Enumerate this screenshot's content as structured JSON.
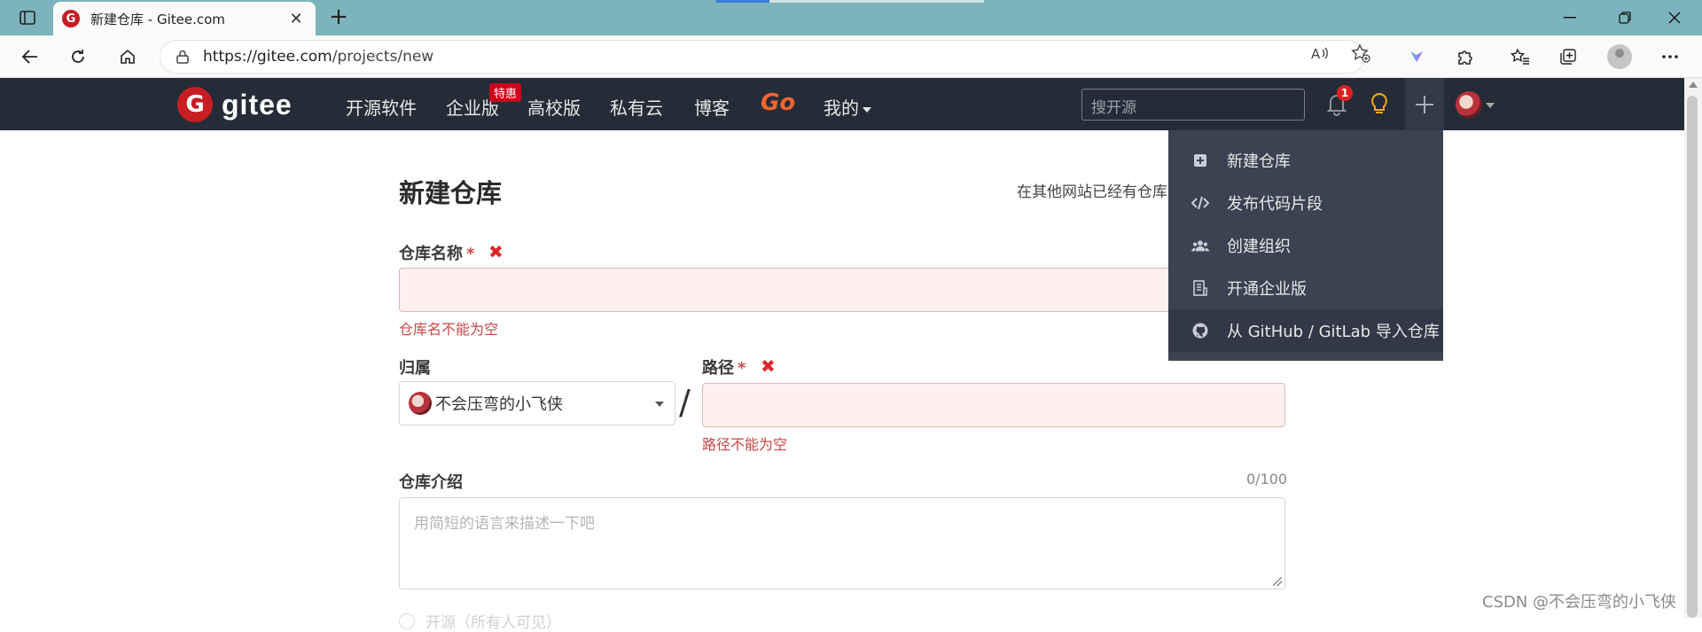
{
  "browser": {
    "tab_title": "新建仓库 - Gitee.com",
    "favicon_letter": "G",
    "url_domain": "https://gitee.com",
    "url_path": "/projects/new"
  },
  "header": {
    "logo_text": "gitee",
    "logo_letter": "G",
    "nav": [
      "开源软件",
      "企业版",
      "高校版",
      "私有云",
      "博客",
      "Go",
      "我的"
    ],
    "hot_badge": "特惠",
    "search_placeholder": "搜开源",
    "notification_count": "1"
  },
  "dropdown": {
    "items": [
      {
        "label": "新建仓库",
        "icon": "plus-square-icon"
      },
      {
        "label": "发布代码片段",
        "icon": "code-icon"
      },
      {
        "label": "创建组织",
        "icon": "users-icon"
      },
      {
        "label": "开通企业版",
        "icon": "building-icon"
      },
      {
        "label": "从 GitHub / GitLab 导入仓库",
        "icon": "github-icon"
      }
    ]
  },
  "form": {
    "title": "新建仓库",
    "import_hint": "在其他网站已经有仓库",
    "repo_name_label": "仓库名称",
    "repo_name_error": "仓库名不能为空",
    "owner_label": "归属",
    "owner_value": "不会压弯的小飞侠",
    "path_label": "路径",
    "path_error": "路径不能为空",
    "required_mark": "*",
    "desc_label": "仓库介绍",
    "desc_counter": "0/100",
    "desc_placeholder": "用简短的语言来描述一下吧",
    "visibility_partial": "开源（所有人可见）"
  },
  "watermark": "CSDN @不会压弯的小飞侠",
  "colors": {
    "header_bg": "#252c38",
    "gitee_red": "#c71d23",
    "go_orange": "#f3662c",
    "error_red": "#db2828",
    "dropdown_bg": "#3b4252"
  }
}
